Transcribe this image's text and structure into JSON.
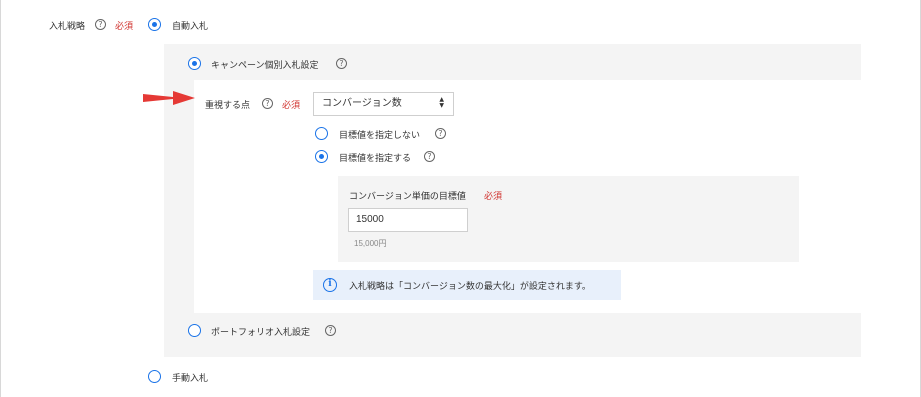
{
  "bid_strategy": {
    "label": "入札戦略",
    "required": "必須",
    "help": "?",
    "auto_bid": {
      "label": "自動入札",
      "selected": true
    },
    "manual_bid": {
      "label": "手動入札",
      "selected": false
    }
  },
  "campaign_setting": {
    "label": "キャンペーン個別入札設定",
    "selected": true,
    "help": "?",
    "focus": {
      "label": "重視する点",
      "required": "必須",
      "help": "?",
      "select_value": "コンバージョン数",
      "select_icon": "up-down-arrows-icon"
    },
    "target_off": {
      "label": "目標値を指定しない",
      "selected": false,
      "help": "?"
    },
    "target_on": {
      "label": "目標値を指定する",
      "selected": true,
      "help": "?"
    },
    "target_panel": {
      "label": "コンバージョン単価の目標値",
      "required": "必須",
      "input_value": "15000",
      "formatted_value": "15,000円"
    },
    "info_icon": "info-icon",
    "info_text": "入札戦略は「コンバージョン数の最大化」が設定されます。"
  },
  "portfolio_setting": {
    "label": "ポートフォリオ入札設定",
    "selected": false,
    "help": "?"
  },
  "colors": {
    "accent": "#1a73e8",
    "required": "#d0312d",
    "annotation_arrow": "#e53935",
    "panel_bg": "#f4f4f4",
    "info_bg": "#e8f0fb"
  }
}
